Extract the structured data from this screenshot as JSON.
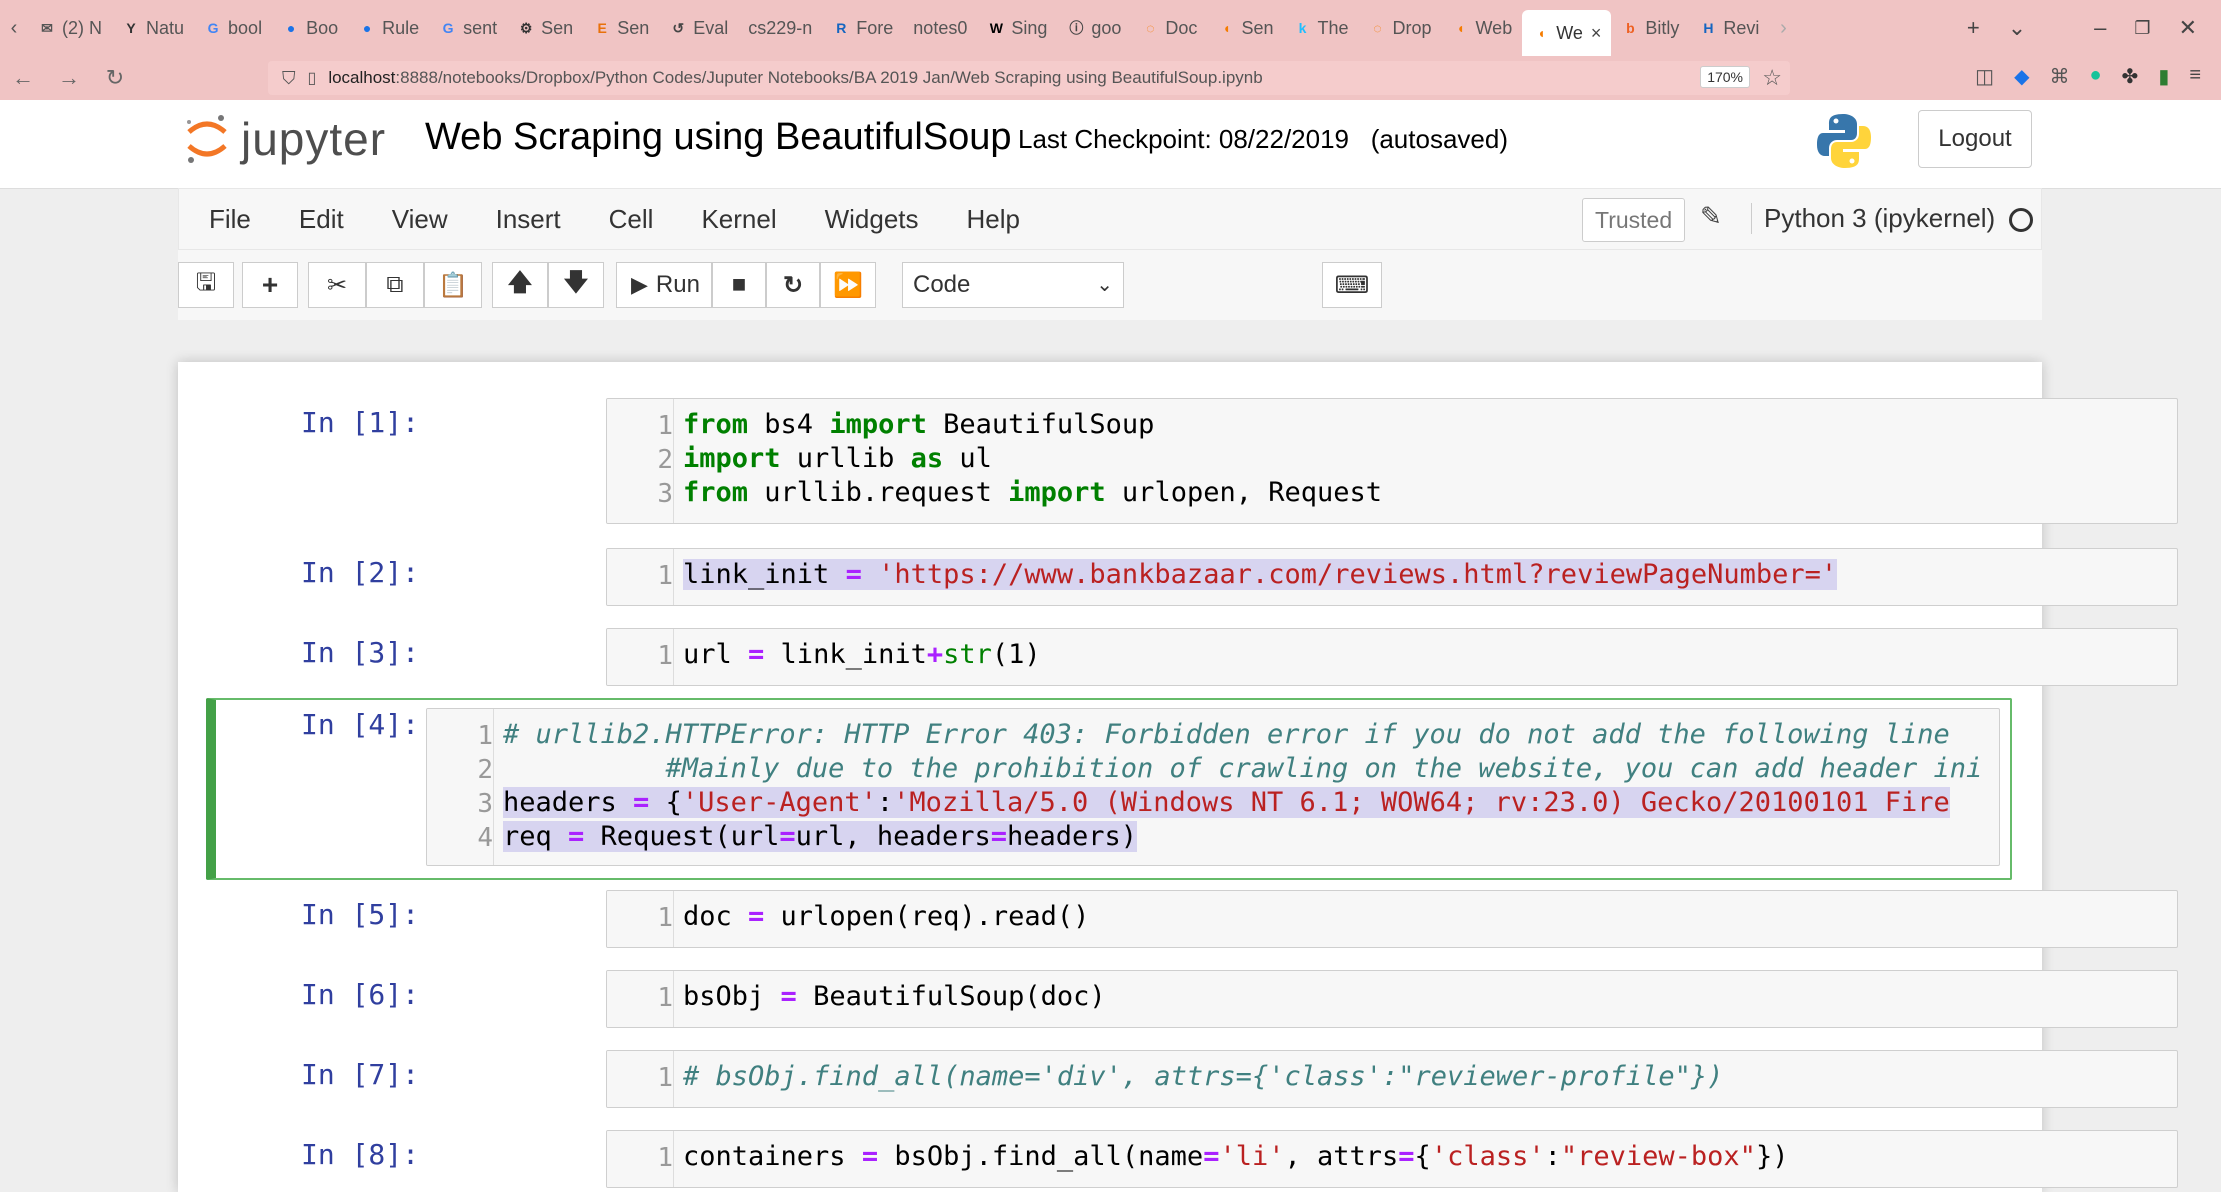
{
  "browser": {
    "tabs": [
      {
        "label": "(2) N",
        "icon": "chat-icon",
        "color": "#555555"
      },
      {
        "label": "Natu",
        "icon": "y-icon",
        "color": "#333333"
      },
      {
        "label": "bool",
        "icon": "google-icon",
        "color": "#4285f4"
      },
      {
        "label": "Boo",
        "icon": "blue-circle-icon",
        "color": "#1a73e8"
      },
      {
        "label": "Rule",
        "icon": "blue-circle-icon",
        "color": "#1a73e8"
      },
      {
        "label": "sent",
        "icon": "google-icon",
        "color": "#4285f4"
      },
      {
        "label": "Sen",
        "icon": "gear-icon",
        "color": "#333333"
      },
      {
        "label": "Sen",
        "icon": "e-icon",
        "color": "#e8710a"
      },
      {
        "label": "Eval",
        "icon": "refresh-icon",
        "color": "#444444"
      },
      {
        "label": "cs229-n",
        "icon": "",
        "color": "#333333"
      },
      {
        "label": "Fore",
        "icon": "r-icon",
        "color": "#1565c0"
      },
      {
        "label": "notes0",
        "icon": "",
        "color": "#333333"
      },
      {
        "label": "Sing",
        "icon": "w-icon",
        "color": "#000000"
      },
      {
        "label": "goo",
        "icon": "info-icon",
        "color": "#444444"
      },
      {
        "label": "Doc",
        "icon": "orange-ring-icon",
        "color": "#f57c00"
      },
      {
        "label": "Sen",
        "icon": "jupyter-icon",
        "color": "#f57c00"
      },
      {
        "label": "The",
        "icon": "k-icon",
        "color": "#20beff"
      },
      {
        "label": "Drop",
        "icon": "orange-ring-icon",
        "color": "#f57c00"
      },
      {
        "label": "Web",
        "icon": "jupyter-icon",
        "color": "#f57c00"
      },
      {
        "label": "We",
        "icon": "jupyter-icon",
        "color": "#f57c00",
        "active": true
      },
      {
        "label": "Bitly",
        "icon": "bitly-icon",
        "color": "#ee6123"
      },
      {
        "label": "Revi",
        "icon": "h-icon",
        "color": "#1565c0"
      }
    ],
    "url_host": "localhost",
    "url_path": ":8888/notebooks/Dropbox/Python Codes/Juputer Notebooks/BA 2019 Jan/Web Scraping using BeautifulSoup.ipynb",
    "zoom": "170%"
  },
  "header": {
    "logo_text": "jupyter",
    "title": "Web Scraping using BeautifulSoup",
    "checkpoint": "Last Checkpoint: 08/22/2019   (autosaved)",
    "logout": "Logout"
  },
  "menu": {
    "items": [
      "File",
      "Edit",
      "View",
      "Insert",
      "Cell",
      "Kernel",
      "Widgets",
      "Help"
    ],
    "trusted": "Trusted",
    "kernel": "Python 3 (ipykernel)"
  },
  "toolbar": {
    "run_label": "Run",
    "cell_type": "Code"
  },
  "cells": [
    {
      "prompt": "In [1]:",
      "lines": [
        "1",
        "2",
        "3"
      ]
    },
    {
      "prompt": "In [2]:",
      "lines": [
        "1"
      ]
    },
    {
      "prompt": "In [3]:",
      "lines": [
        "1"
      ]
    },
    {
      "prompt": "In [4]:",
      "lines": [
        "1",
        "2",
        "3",
        "4"
      ]
    },
    {
      "prompt": "In [5]:",
      "lines": [
        "1"
      ]
    },
    {
      "prompt": "In [6]:",
      "lines": [
        "1"
      ]
    },
    {
      "prompt": "In [7]:",
      "lines": [
        "1"
      ]
    },
    {
      "prompt": "In [8]:",
      "lines": [
        "1"
      ]
    }
  ],
  "code": {
    "c1": {
      "l1": {
        "a": "from",
        "b": " bs4 ",
        "c": "import",
        "d": " BeautifulSoup"
      },
      "l2": {
        "a": "import",
        "b": " urllib ",
        "c": "as",
        "d": " ul"
      },
      "l3": {
        "a": "from",
        "b": " urllib.request ",
        "c": "import",
        "d": " urlopen, Request"
      }
    },
    "c2": {
      "var": "link_init ",
      "eq": "=",
      "str": " 'https://www.bankbazaar.com/reviews.html?reviewPageNumber='"
    },
    "c3": {
      "var": "url ",
      "eq": "=",
      "mid": " link_init",
      "plus": "+",
      "fn": "str",
      "arg": "(1)"
    },
    "c4": {
      "l1": "# urllib2.HTTPError: HTTP Error 403: Forbidden error if you do not add the following line",
      "l2": "          #Mainly due to the prohibition of crawling on the website, you can add header ini",
      "l3": {
        "var": "headers ",
        "eq": "=",
        "open": " {",
        "key": "'User-Agent'",
        "colon": ":",
        "val": "'Mozilla/5.0 (Windows NT 6.1; WOW64; rv:23.0) Gecko/20100101 Fire"
      },
      "l4": {
        "a": "req ",
        "eq": "=",
        "b": " Request(url",
        "eq2": "=",
        "c": "url, headers",
        "eq3": "=",
        "d": "headers)"
      }
    },
    "c5": {
      "var": "doc ",
      "eq": "=",
      "rest": " urlopen(req).read()"
    },
    "c6": {
      "var": "bsObj ",
      "eq": "=",
      "rest": " BeautifulSoup(doc)"
    },
    "c7": {
      "comment": "# bsObj.find_all(name='div', attrs={'class':\"reviewer-profile\"})"
    },
    "c8": {
      "var": "containers ",
      "eq": "=",
      "a": " bsObj.find_all(name",
      "eq2": "=",
      "s1": "'li'",
      "b": ", attrs",
      "eq3": "=",
      "c": "{",
      "s2": "'class'",
      "d": ":",
      "s3": "\"review-box\"",
      "e": "})"
    }
  }
}
